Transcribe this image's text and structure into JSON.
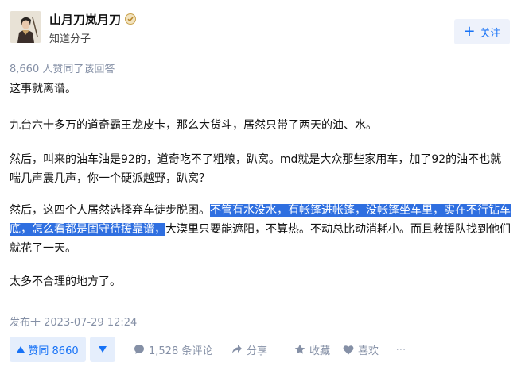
{
  "author": {
    "name": "山月刀岚月刀",
    "title": "知道分子",
    "follow_label": "关注",
    "follow_plus": "+"
  },
  "answer": {
    "likes_summary": "8,660 人赞同了该回答",
    "paragraphs": {
      "p1": "这事就离谱。",
      "p2": "九台六十多万的道奇霸王龙皮卡，那么大货斗，居然只带了两天的油、水。",
      "p3": "然后，叫来的油车油是92的，道奇吃不了粗粮，趴窝。md就是大众那些家用车，加了92的油不也就喘几声震几声，你一个硬派越野，趴窝？",
      "p4_before": "然后，这四个人居然选择弃车徒步脱困。",
      "p4_highlight": "不管有水没水，有帐篷进帐篷，没帐篷坐车里，实在不行钻车底，怎么看都是固守待援靠谱，",
      "p4_after": "大漠里只要能遮阳，不算热。不动总比动消耗小。而且救援队找到他们就花了一天。",
      "p5": "太多不合理的地方了。"
    },
    "publish_time": "发布于 2023-07-29 12:24"
  },
  "actions": {
    "vote_up_label": "赞同 8660",
    "comment_label": "1,528 条评论",
    "share_label": "分享",
    "favorite_label": "收藏",
    "like_label": "喜欢",
    "more_label": "⋯"
  },
  "colors": {
    "accent": "#1772f6",
    "accent_bg": "#e5eefc",
    "muted": "#8590a6",
    "highlight": "#2f6fe0"
  }
}
